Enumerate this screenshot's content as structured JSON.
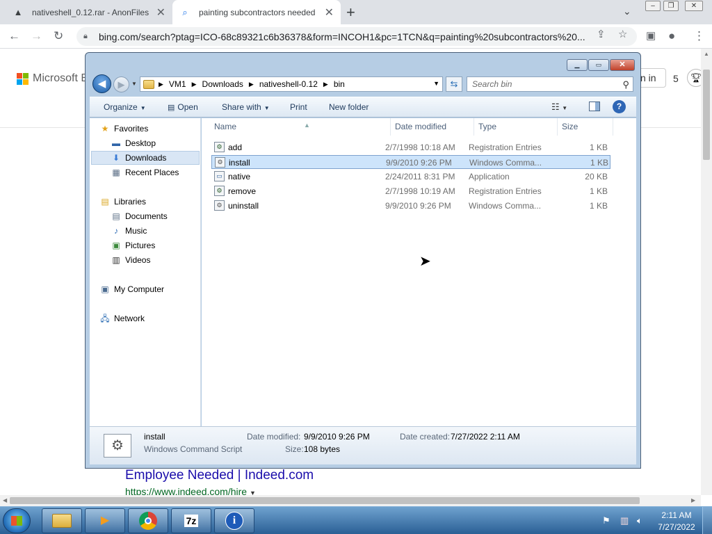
{
  "browser": {
    "tabs": [
      {
        "title": "nativeshell_0.12.rar - AnonFiles",
        "icon": "anonfiles-icon"
      },
      {
        "title": "painting subcontractors needed",
        "icon": "search-icon"
      }
    ],
    "url": "bing.com/search?ptag=ICO-68c89321c6b36378&form=INCOH1&pc=1TCN&q=painting%20subcontractors%20..."
  },
  "bing": {
    "logo_text": "Microsoft Bi",
    "signin_label": "n in",
    "rewards_count": "5",
    "result_title": "Employee Needed | Indeed.com",
    "result_url": "https://www.indeed.com/hire",
    "logo_colors": [
      "#f25022",
      "#7fba00",
      "#00a4ef",
      "#ffb900"
    ]
  },
  "explorer": {
    "breadcrumbs": [
      "VM1",
      "Downloads",
      "nativeshell-0.12",
      "bin"
    ],
    "search_placeholder": "Search bin",
    "commands": {
      "organize": "Organize",
      "open": "Open",
      "share_with": "Share with",
      "print": "Print",
      "new_folder": "New folder"
    },
    "nav": {
      "favorites": "Favorites",
      "desktop": "Desktop",
      "downloads": "Downloads",
      "recent_places": "Recent Places",
      "libraries": "Libraries",
      "documents": "Documents",
      "music": "Music",
      "pictures": "Pictures",
      "videos": "Videos",
      "my_computer": "My Computer",
      "network": "Network"
    },
    "columns": {
      "name": "Name",
      "date": "Date modified",
      "type": "Type",
      "size": "Size"
    },
    "files": [
      {
        "name": "add",
        "date": "2/7/1998 10:18 AM",
        "type": "Registration Entries",
        "size": "1 KB",
        "icon": "registry-file-icon"
      },
      {
        "name": "install",
        "date": "9/9/2010 9:26 PM",
        "type": "Windows Comma...",
        "size": "1 KB",
        "icon": "script-file-icon",
        "selected": true
      },
      {
        "name": "native",
        "date": "2/24/2011 8:31 PM",
        "type": "Application",
        "size": "20 KB",
        "icon": "application-file-icon"
      },
      {
        "name": "remove",
        "date": "2/7/1998 10:19 AM",
        "type": "Registration Entries",
        "size": "1 KB",
        "icon": "registry-file-icon"
      },
      {
        "name": "uninstall",
        "date": "9/9/2010 9:26 PM",
        "type": "Windows Comma...",
        "size": "1 KB",
        "icon": "script-file-icon"
      }
    ],
    "details": {
      "name": "install",
      "type": "Windows Command Script",
      "modified_label": "Date modified:",
      "modified_value": "9/9/2010 9:26 PM",
      "created_label": "Date created:",
      "created_value": "7/27/2022 2:11 AM",
      "size_label": "Size:",
      "size_value": "108 bytes"
    }
  },
  "taskbar": {
    "items": [
      "file-explorer-icon",
      "media-player-icon",
      "chrome-icon",
      "7zip-icon",
      "info-icon"
    ],
    "seven_zip_label": "7z",
    "info_label": "i",
    "time": "2:11 AM",
    "date": "7/27/2022"
  }
}
